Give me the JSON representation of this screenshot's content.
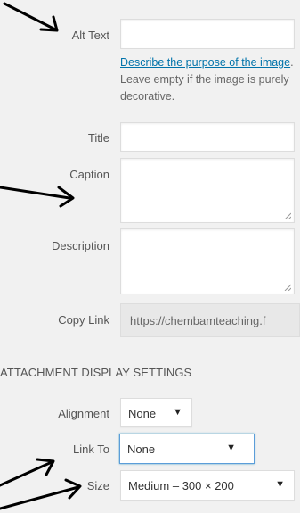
{
  "attachment": {
    "alt_text_label": "Alt Text",
    "alt_text_value": "",
    "help_link": "Describe the purpose of the image",
    "help_rest": ". Leave empty if the image is purely decorative.",
    "title_label": "Title",
    "title_value": "",
    "caption_label": "Caption",
    "caption_value": "",
    "description_label": "Description",
    "description_value": "",
    "copy_link_label": "Copy Link",
    "copy_link_value": "https://chembamteaching.f"
  },
  "display_settings": {
    "heading": "ATTACHMENT DISPLAY SETTINGS",
    "alignment_label": "Alignment",
    "alignment_value": "None",
    "link_to_label": "Link To",
    "link_to_value": "None",
    "size_label": "Size",
    "size_value": "Medium – 300 × 200"
  },
  "colors": {
    "link": "#0073aa",
    "focus_border": "#5b9dd9",
    "arrow": "#000000"
  }
}
